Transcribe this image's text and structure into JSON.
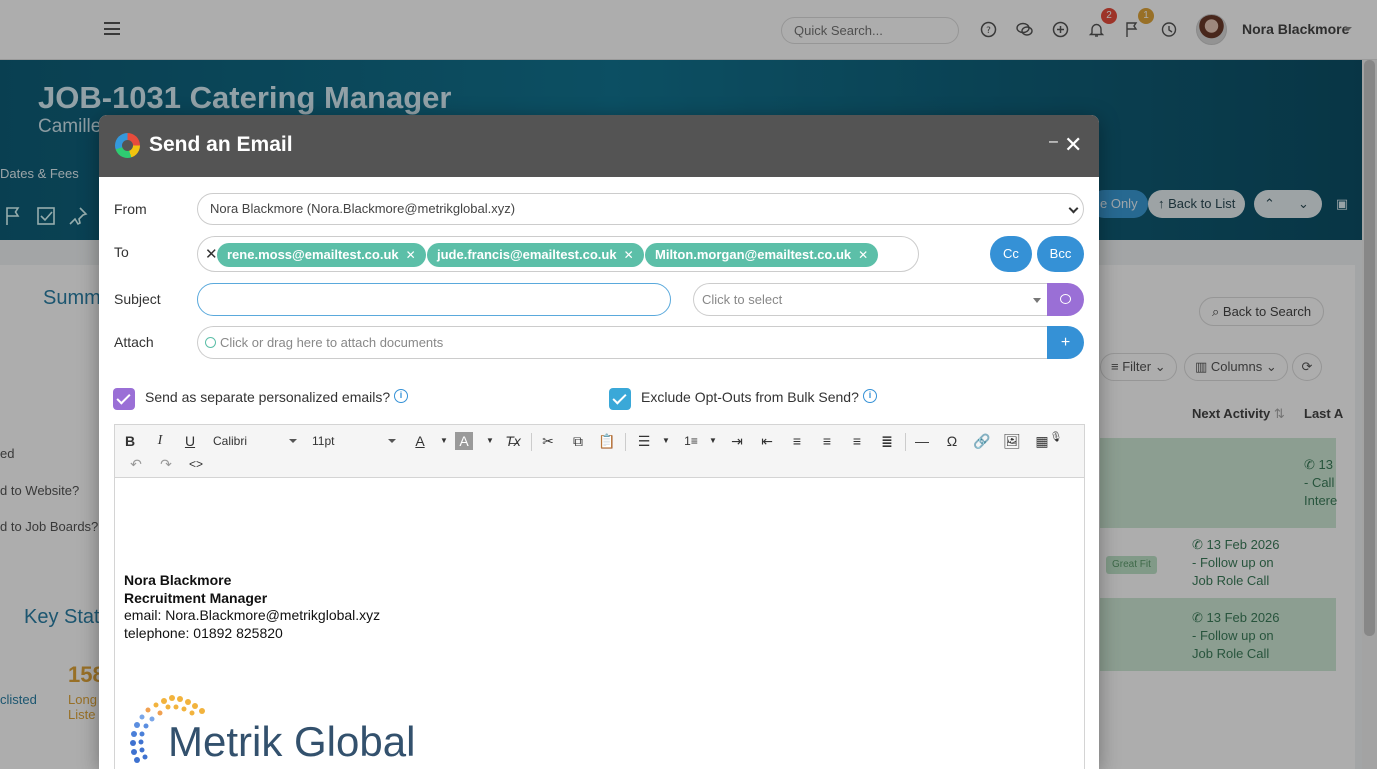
{
  "topbar": {
    "search_placeholder": "Quick Search...",
    "notifications_count": "2",
    "flags_count": "1",
    "user_name": "Nora Blackmore"
  },
  "hero": {
    "job_title": "JOB-1031 Catering Manager",
    "subtitle": "Camille",
    "tab_dates": "Dates & Fees",
    "btn_read_only": "e Only",
    "btn_back_to_list": "Back to List"
  },
  "background": {
    "summary_title": "Summ",
    "labels": [
      "ed",
      "d to Website?",
      "d to Job Boards?"
    ],
    "key_stats_title": "Key Stat",
    "stat_value": "158",
    "stat_label_1": "Long",
    "stat_label_2": "Liste",
    "stat_shortlisted": "clisted",
    "back_to_search": "Back to Search",
    "filter": "Filter",
    "columns": "Columns",
    "col_next_activity": "Next Activity",
    "col_last": "Last A",
    "good_fit": "Great Fit",
    "activities": [
      {
        "date": "13 Feb 2026",
        "line1": "- Follow up on",
        "line2": "Job Role Call"
      },
      {
        "date": "13 Feb 2026",
        "line1": "- Follow up on",
        "line2": "Job Role Call"
      }
    ],
    "last_activity_fragments": [
      "13",
      "- Call",
      "Intere"
    ]
  },
  "modal": {
    "title": "Send an Email",
    "from_label": "From",
    "from_value": "Nora Blackmore (Nora.Blackmore@metrikglobal.xyz)",
    "to_label": "To",
    "recipients": [
      "rene.moss@emailtest.co.uk",
      "jude.francis@emailtest.co.uk",
      "Milton.morgan@emailtest.co.uk"
    ],
    "cc_label": "Cc",
    "bcc_label": "Bcc",
    "subject_label": "Subject",
    "subject_value": "",
    "template_placeholder": "Click to select",
    "attach_label": "Attach",
    "attach_placeholder": "Click or drag here to attach documents",
    "attach_add": "+",
    "option_separate": "Send as separate personalized emails?",
    "option_exclude": "Exclude Opt-Outs from Bulk Send?",
    "editor": {
      "font_name": "Calibri",
      "font_size": "11pt"
    },
    "signature": {
      "name": "Nora Blackmore",
      "role": "Recruitment Manager",
      "email": "email: Nora.Blackmore@metrikglobal.xyz",
      "phone": "telephone: 01892 825820",
      "company": "Metrik Global"
    }
  },
  "colors": {
    "teal_chip": "#5cbfa8",
    "blue_button": "#3591d6",
    "purple_button": "#9a6fd6",
    "modal_header": "#545454",
    "hero": "#137592"
  }
}
